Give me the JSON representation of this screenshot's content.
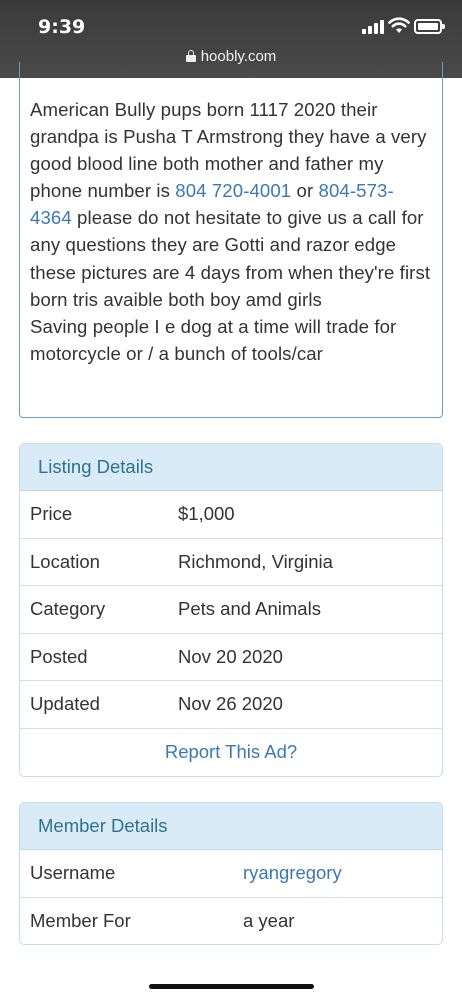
{
  "status_bar": {
    "time": "9:39",
    "url": "hoobly.com"
  },
  "description": {
    "text_before_phone1": "American Bully pups born 1117 2020 their grandpa is Pusha T Armstrong they have a very good blood line both mother and father my phone number is ",
    "phone1": "804 720-4001",
    "text_between": " or ",
    "phone2": "804-573-4364",
    "text_after_phone2": " please do not hesitate to give us a call for any questions they are Gotti and razor edge these pictures are 4 days from when they're first born tris avaible both boy amd girls\nSaving people I e dog at a time will trade for motorcycle or / a bunch of tools/car"
  },
  "listing_details": {
    "title": "Listing Details",
    "rows": [
      {
        "label": "Price",
        "value": "$1,000"
      },
      {
        "label": "Location",
        "value": "Richmond, Virginia"
      },
      {
        "label": "Category",
        "value": "Pets and Animals"
      },
      {
        "label": "Posted",
        "value": "Nov 20 2020"
      },
      {
        "label": "Updated",
        "value": "Nov 26 2020"
      }
    ],
    "report_link": "Report This Ad?"
  },
  "member_details": {
    "title": "Member Details",
    "rows": [
      {
        "label": "Username",
        "value": "ryangregory"
      },
      {
        "label": "Member For",
        "value": "a year"
      }
    ]
  },
  "colors": {
    "link": "#3b79b4",
    "panel_header_bg": "#d9ebf6",
    "panel_header_text": "#31708f",
    "description_border": "#6e9dc4"
  }
}
